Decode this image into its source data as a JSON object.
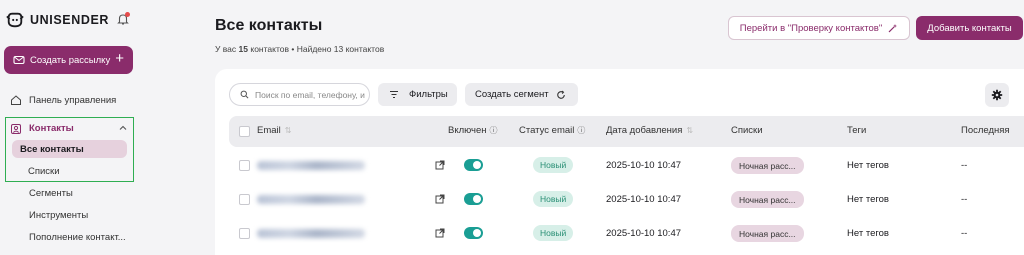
{
  "sidebar": {
    "logo_text": "UNISENDER",
    "cta_label": "Создать рассылку",
    "cta_plus": "+",
    "dashboard_label": "Панель управления",
    "contacts_label": "Контакты",
    "contacts_sub": [
      "Все контакты",
      "Списки"
    ],
    "more_items": [
      "Сегменты",
      "Инструменты",
      "Пополнение контакт..."
    ]
  },
  "header": {
    "title": "Все контакты",
    "sub_prefix": "У вас",
    "sub_count": "15",
    "sub_suffix": "контактов • Найдено 13 контактов",
    "verify_button": "Перейти в \"Проверку контактов\"",
    "add_button": "Добавить контакты"
  },
  "toolbar": {
    "search_placeholder": "Поиск по email, телефону, и",
    "filter_label": "Фильтры",
    "segment_label": "Создать сегмент"
  },
  "table": {
    "columns": [
      "Email",
      "Включен",
      "Статус email",
      "Дата добавления",
      "Списки",
      "Теги",
      "Последняя"
    ],
    "rows": [
      {
        "status": "Новый",
        "date": "2025-10-10 10:47",
        "list": "Ночная расс...",
        "tags": "Нет тегов",
        "last": "--"
      },
      {
        "status": "Новый",
        "date": "2025-10-10 10:47",
        "list": "Ночная расс...",
        "tags": "Нет тегов",
        "last": "--"
      },
      {
        "status": "Новый",
        "date": "2025-10-10 10:47",
        "list": "Ночная расс...",
        "tags": "Нет тегов",
        "last": "--"
      }
    ]
  },
  "colors": {
    "brand": "#8a2c6b",
    "toggle_on": "#1a9e94",
    "status_new_bg": "#d7efe8",
    "highlight_box": "#2fae52"
  }
}
